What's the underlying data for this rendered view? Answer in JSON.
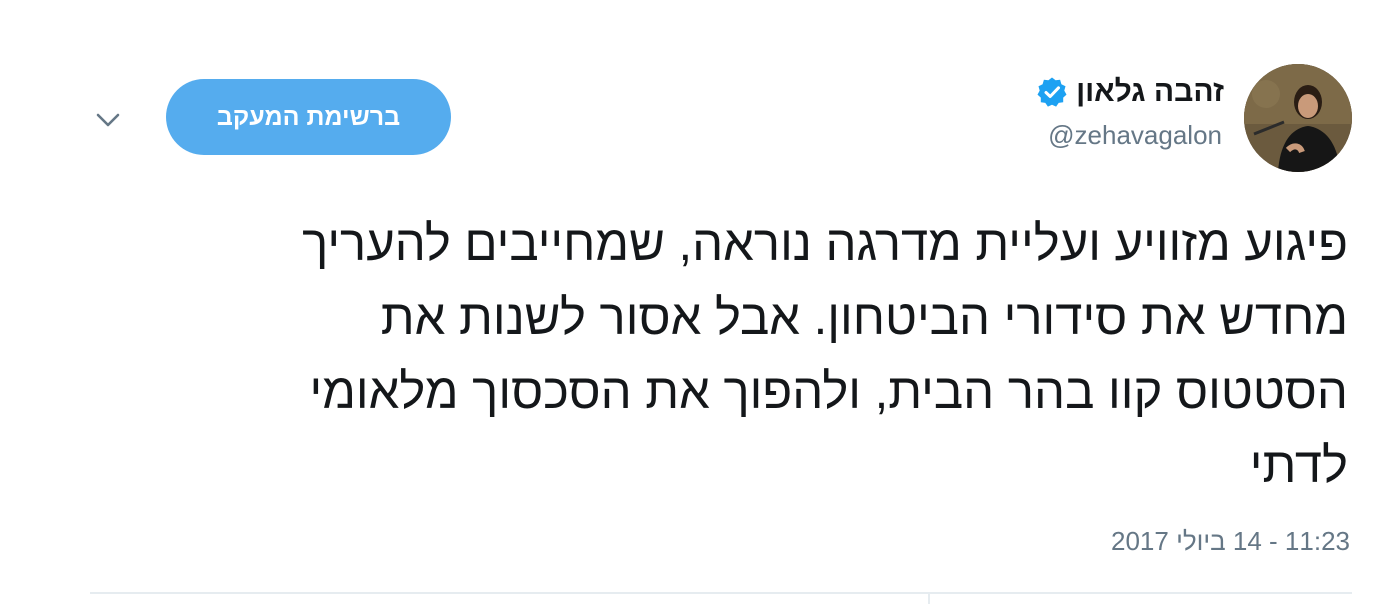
{
  "author": {
    "display_name": "זהבה גלאון",
    "handle": "@zehavagalon",
    "verified": true
  },
  "actions": {
    "follow_label": "ברשימת המעקב"
  },
  "tweet": {
    "text": "פיגוע מזוויע ועליית מדרגה נוראה, שמחייבים להעריך\nמחדש את סידורי הביטחון. אבל אסור לשנות את\nהסטטוס קוו בהר הבית, ולהפוך את הסכסוך מלאומי\nלדתי",
    "timestamp": "11:23 - 14 ביולי 2017"
  },
  "icons": {
    "verified": "verified-badge-icon",
    "caret": "chevron-down-icon"
  },
  "colors": {
    "accent": "#55acee",
    "verified": "#1da1f2",
    "secondary_text": "#657786",
    "primary_text": "#14171a"
  }
}
